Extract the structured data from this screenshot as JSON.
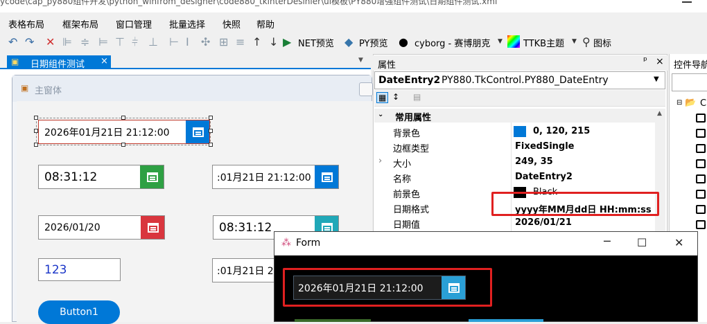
{
  "window": {
    "title": "ycode\\cap_py880组件开发\\python_winfrom_designer\\code880_tkinterDesinier\\ui模板\\PY880增强组件测试\\日期组件测试.xml"
  },
  "menu": [
    "表格布局",
    "框架布局",
    "窗口管理",
    "批量选择",
    "快照",
    "帮助"
  ],
  "toolbar": {
    "net_preview": "NET预览",
    "py_preview": "PY预览",
    "theme": "cyborg - 赛博朋克",
    "ttkb_theme": "TTKB主题",
    "icon_label": "图标"
  },
  "designer": {
    "tab_label": "日期组件测试",
    "tab_close": "×",
    "form_title": "主窗体",
    "entries": {
      "entry_main": "2026年01月21日 21:12:00",
      "entry_time1": "08:31:12",
      "entry_dt2": ":01月21日 21:12:00",
      "entry_date": "2026/01/20",
      "entry_time2": "08:31:12",
      "entry_num": "123",
      "entry_dt3": ":01月21日 21:12:00"
    },
    "button1": "Button1"
  },
  "properties": {
    "header": "属性",
    "pin": "ᵖ",
    "close": "×",
    "object_name": "DateEntry2",
    "object_type": "PY880.TkControl.PY880_DateEntry",
    "category": "常用属性",
    "rows": [
      {
        "name": "背景色",
        "value": "0, 120, 215",
        "swatch": "#0078d7"
      },
      {
        "name": "边框类型",
        "value": "FixedSingle"
      },
      {
        "name": "大小",
        "value": "249, 35",
        "expandable": true
      },
      {
        "name": "名称",
        "value": "DateEntry2"
      },
      {
        "name": "前景色",
        "value": "Black",
        "swatch": "#000000"
      },
      {
        "name": "日期格式",
        "value": "yyyy年MM月dd日 HH:mm:ss"
      },
      {
        "name": "日期值",
        "value": "2026/01/21"
      }
    ]
  },
  "controls_panel": {
    "header": "控件导航",
    "root": "C"
  },
  "popup": {
    "title": "Form",
    "entry_value": "2026年01月21日 21:12:00",
    "minimize": "─",
    "maximize": "☐",
    "close": "✕"
  },
  "colors": {
    "accent": "#0078d7",
    "green_btn": "#2ea043",
    "red_btn": "#d9363e",
    "teal_btn": "#20a8b8",
    "highlight": "#e02020"
  }
}
